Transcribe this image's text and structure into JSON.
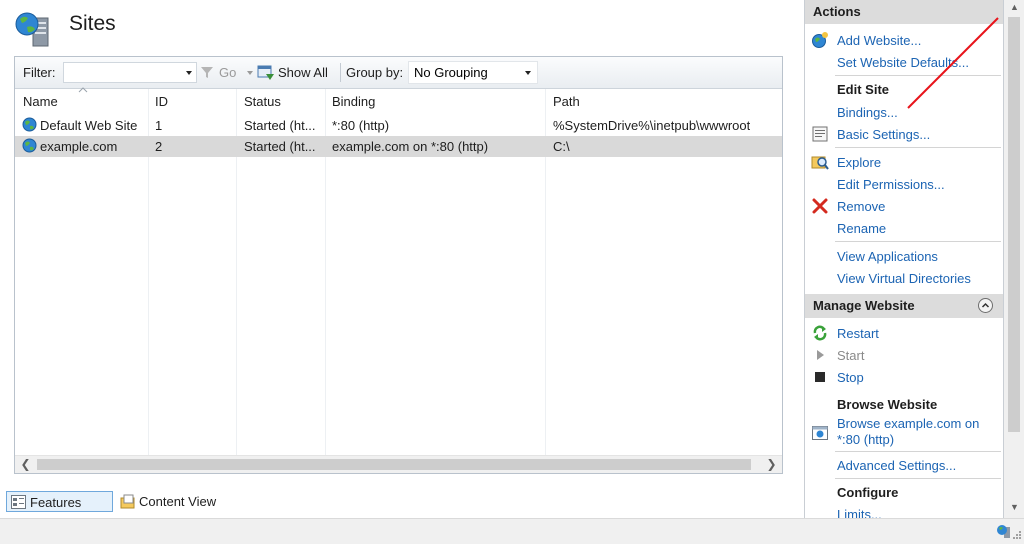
{
  "header": {
    "title": "Sites"
  },
  "toolbar": {
    "filter_label": "Filter:",
    "filter_value": "",
    "go_label": "Go",
    "show_all_label": "Show All",
    "group_by_label": "Group by:",
    "group_by_value": "No Grouping"
  },
  "table": {
    "columns": [
      "Name",
      "ID",
      "Status",
      "Binding",
      "Path"
    ],
    "rows": [
      {
        "name": "Default Web Site",
        "id": "1",
        "status": "Started (ht...",
        "binding": "*:80 (http)",
        "path": "%SystemDrive%\\inetpub\\wwwroot",
        "selected": false
      },
      {
        "name": "example.com",
        "id": "2",
        "status": "Started (ht...",
        "binding": "example.com on *:80 (http)",
        "path": "C:\\",
        "selected": true
      }
    ]
  },
  "view_tabs": {
    "features": "Features View",
    "content": "Content View"
  },
  "actions": {
    "title": "Actions",
    "add_website": "Add Website...",
    "set_defaults": "Set Website Defaults...",
    "edit_site": {
      "title": "Edit Site",
      "bindings": "Bindings...",
      "basic_settings": "Basic Settings...",
      "explore": "Explore",
      "edit_permissions": "Edit Permissions...",
      "remove": "Remove",
      "rename": "Rename",
      "view_applications": "View Applications",
      "view_virtual_directories": "View Virtual Directories"
    },
    "manage": {
      "title": "Manage Website",
      "restart": "Restart",
      "start": "Start",
      "stop": "Stop",
      "browse_title": "Browse Website",
      "browse_line1": "Browse example.com on",
      "browse_line2": "*:80 (http)",
      "advanced_settings": "Advanced Settings...",
      "configure_title": "Configure",
      "limits": "Limits..."
    }
  },
  "colors": {
    "link": "#1c64b3",
    "annotation": "#e8141b",
    "selection": "#d9d9d9"
  }
}
